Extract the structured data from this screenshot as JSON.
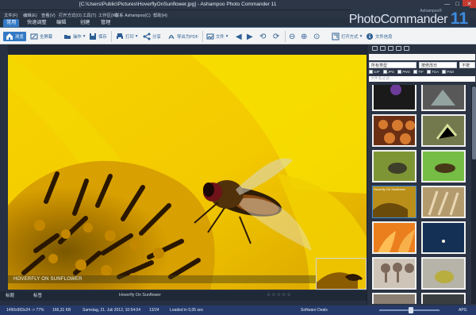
{
  "window": {
    "title": "[C:\\Users\\Public\\Pictures\\HoverflyOnSunflower.jpg] - Ashampoo Photo Commander 11",
    "controls": [
      "—",
      "□",
      "✕"
    ]
  },
  "menu": [
    "文件(F)",
    "编辑(E)",
    "查看(V)",
    "打开方式(O)",
    "工具(T)",
    "工作区(W)",
    "联系 Ashampoo(C)",
    "帮助(H)"
  ],
  "brand": {
    "small": "Ashampoo®",
    "name": "PhotoCommander",
    "version": "11"
  },
  "tabs": [
    "常用",
    "快速调整",
    "编辑",
    "创建",
    "管理"
  ],
  "toolbar": {
    "browse": "浏览",
    "fullscreen": "全屏幕",
    "operation": "操作",
    "save": "保存",
    "print": "打印",
    "share": "分享",
    "export_pdf": "导出为PDF",
    "file": "文件",
    "open_with": "打开方式",
    "file_info": "文件信息"
  },
  "viewer": {
    "caption": "HOVERFLY ON SUNFLOWER",
    "image_name": "Hoverfly On Sunflower"
  },
  "controls": {
    "label_left": "标题",
    "label_right": "标签"
  },
  "panel": {
    "search": "",
    "type": "所有类型",
    "sort": "按修改日",
    "sort2": "不按"
  },
  "file_types": [
    "GIF",
    "JPG",
    "PNG",
    "TIF",
    "TGA",
    "PSD"
  ],
  "filter_placeholder": "文件名过滤...",
  "filter_placeholder2": "按EXIF过滤...",
  "thumbs": [
    {
      "caption": "",
      "color": "#1a1a1a"
    },
    {
      "caption": "",
      "color": "#565656"
    },
    {
      "caption": "",
      "color": "#c9703f"
    },
    {
      "caption": "",
      "color": "#7a7e54"
    },
    {
      "caption": "",
      "color": "#7f983b"
    },
    {
      "caption": "",
      "color": "#7bc344"
    },
    {
      "caption": "Hoverfly On Sunflower",
      "color": "#c09a20"
    },
    {
      "caption": "",
      "color": "#b9a06f"
    },
    {
      "caption": "",
      "color": "#f0811e"
    },
    {
      "caption": "",
      "color": "#173153"
    },
    {
      "caption": "",
      "color": "#cfc8bd"
    },
    {
      "caption": "",
      "color": "#b5b4aa"
    },
    {
      "caption": "",
      "color": "#8a7f72"
    },
    {
      "caption": "",
      "color": "#3a3d40"
    }
  ],
  "status": {
    "dimensions": "1490x993x24 -> 77%",
    "size": "166,31 KB",
    "date": "Samstag, 21. Juli 2012, 10:54:04",
    "count": "13/24",
    "load": "Loaded in 0,05 sec",
    "deals": "Software Deals",
    "apg": "APG"
  },
  "colors": {
    "accent": "#3479c5",
    "toolbar": "#f2f3f4",
    "status": "#253a6b",
    "panel": "#2b3444"
  }
}
